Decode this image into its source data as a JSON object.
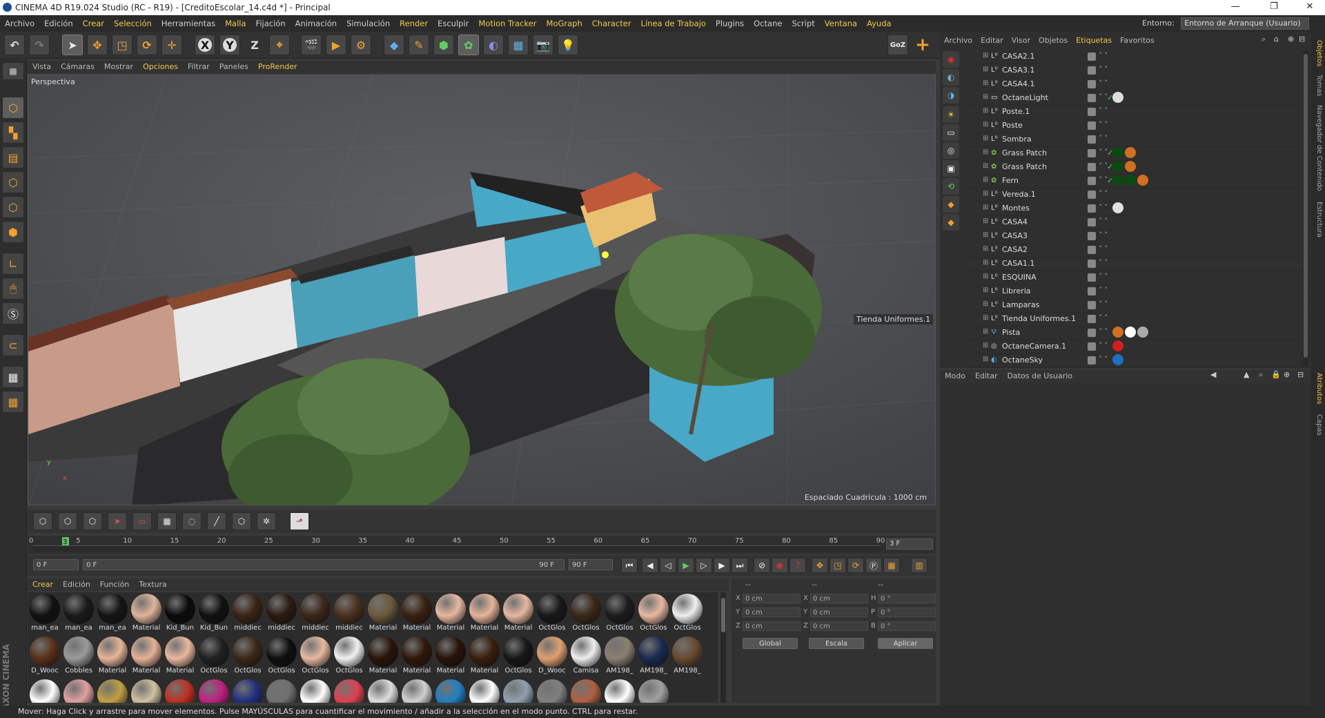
{
  "window": {
    "title": "CINEMA 4D R19.024 Studio (RC - R19) - [CreditoEscolar_14.c4d *] - Principal",
    "controls": [
      "—",
      "❐",
      "✕"
    ]
  },
  "menubar": {
    "items": [
      "Archivo",
      "Edición",
      "Crear",
      "Selección",
      "Herramientas",
      "Malla",
      "Fijación",
      "Animación",
      "Simulación",
      "Render",
      "Esculpir",
      "Motion Tracker",
      "MoGraph",
      "Character",
      "Línea de Trabajo",
      "Plugins",
      "Octane",
      "Script",
      "Ventana",
      "Ayuda"
    ],
    "highlighted": [
      "Crear",
      "Selección",
      "Malla",
      "Render",
      "Motion Tracker",
      "MoGraph",
      "Character",
      "Línea de Trabajo",
      "Ventana",
      "Ayuda"
    ],
    "env_label": "Entorno:",
    "env_value": "Entorno de Arranque (Usuario)"
  },
  "viewport": {
    "menu": [
      "Vista",
      "Cámaras",
      "Mostrar",
      "Opciones",
      "Filtrar",
      "Paneles",
      "ProRender"
    ],
    "menu_highlighted": [
      "Opciones",
      "ProRender"
    ],
    "label": "Perspectiva",
    "grid_info": "Espaciado Cuadrícula : 1000 cm",
    "object_label": "Tienda Uniformes.1",
    "axis_y": "y",
    "axis_x": "x"
  },
  "timeline": {
    "ticks": [
      "0",
      "5",
      "10",
      "15",
      "20",
      "25",
      "30",
      "35",
      "40",
      "45",
      "50",
      "55",
      "60",
      "65",
      "70",
      "75",
      "80",
      "85",
      "90"
    ],
    "current_marker": "3",
    "current_frame": "3 F",
    "start_field": "0 F",
    "range_start": "0 F",
    "range_end": "90 F",
    "end_field": "90 F"
  },
  "materials": {
    "menu": [
      "Crear",
      "Edición",
      "Función",
      "Textura"
    ],
    "menu_highlighted": [
      "Crear"
    ],
    "row1": [
      {
        "name": "man_ea",
        "color": "#111111"
      },
      {
        "name": "man_ea",
        "color": "#1a1a1a"
      },
      {
        "name": "man_ea",
        "color": "#141414"
      },
      {
        "name": "Material",
        "color": "#e0b49a"
      },
      {
        "name": "Kid_Bun",
        "color": "#0a0a0a"
      },
      {
        "name": "Kid_Bun",
        "color": "#101010"
      },
      {
        "name": "middiec",
        "color": "#3a2414"
      },
      {
        "name": "middiec",
        "color": "#2a1a10"
      },
      {
        "name": "middiec",
        "color": "#3c2618"
      },
      {
        "name": "middiec",
        "color": "#4a301c"
      },
      {
        "name": "Material",
        "color": "#6b5a3a"
      },
      {
        "name": "Material",
        "color": "#3a2010"
      },
      {
        "name": "Material",
        "color": "#e8b8a0"
      },
      {
        "name": "Material",
        "color": "#e6b498"
      },
      {
        "name": "Material",
        "color": "#e8b8a0"
      },
      {
        "name": "OctGlos",
        "color": "#181818"
      },
      {
        "name": "OctGlos",
        "color": "#3a2818"
      },
      {
        "name": "OctGlos",
        "color": "#1c1c1c"
      },
      {
        "name": "OctGlos",
        "color": "#e8b8a0"
      },
      {
        "name": "OctGlos",
        "color": "#f0f0f0"
      }
    ],
    "row2": [
      {
        "name": "D_Wooc",
        "color": "#5a3018"
      },
      {
        "name": "Cobbles",
        "color": "#9a9a9a"
      },
      {
        "name": "Material",
        "color": "#e6b498"
      },
      {
        "name": "Material",
        "color": "#e4b296"
      },
      {
        "name": "Material",
        "color": "#e8b8a0"
      },
      {
        "name": "OctGlos",
        "color": "#202020"
      },
      {
        "name": "OctGlos",
        "color": "#3a2818"
      },
      {
        "name": "OctGlos",
        "color": "#0e0e0e"
      },
      {
        "name": "OctGlos",
        "color": "#e8b8a0"
      },
      {
        "name": "OctGlos",
        "color": "#f2f2f2"
      },
      {
        "name": "Material",
        "color": "#2a1408"
      },
      {
        "name": "Material",
        "color": "#301808"
      },
      {
        "name": "Material",
        "color": "#281208"
      },
      {
        "name": "Material",
        "color": "#3a1e0c"
      },
      {
        "name": "OctGlos",
        "color": "#161616"
      },
      {
        "name": "D_Wooc",
        "color": "#e0a070"
      },
      {
        "name": "Camisa",
        "color": "#eeeeee"
      },
      {
        "name": "AM198_",
        "color": "#8a8070"
      },
      {
        "name": "AM198_",
        "color": "#1a2a50"
      },
      {
        "name": "AM198_",
        "color": "#6a4a30"
      }
    ],
    "row3_colors": [
      "#ffffff",
      "#e0a0a0",
      "#c0a040",
      "#d0c0a0",
      "#c03020",
      "#c02080",
      "#203080",
      "#707070",
      "#ffffff",
      "#e04050",
      "#dddddd",
      "#d0d0d0",
      "#2080c0",
      "#ffffff",
      "#90a0b0",
      "#808080",
      "#b06040",
      "#ffffff",
      "#a0a0a0"
    ]
  },
  "coordinates": {
    "headers": [
      "--",
      "--",
      "--"
    ],
    "rows": [
      {
        "a": "X",
        "av": "0 cm",
        "b": "X",
        "bv": "0 cm",
        "c": "H",
        "cv": "0 °"
      },
      {
        "a": "Y",
        "av": "0 cm",
        "b": "Y",
        "bv": "0 cm",
        "c": "P",
        "cv": "0 °"
      },
      {
        "a": "Z",
        "av": "0 cm",
        "b": "Z",
        "bv": "0 cm",
        "c": "B",
        "cv": "0 °"
      }
    ],
    "mode1": "Global",
    "mode2": "Escala",
    "apply": "Aplicar"
  },
  "object_manager": {
    "menu": [
      "Archivo",
      "Editar",
      "Visor",
      "Objetos",
      "Etiquetas",
      "Favoritos"
    ],
    "menu_highlighted": [
      "Etiquetas"
    ],
    "objects": [
      {
        "name": "CASA2.1",
        "icon": "null",
        "tags": []
      },
      {
        "name": "CASA3.1",
        "icon": "null",
        "tags": []
      },
      {
        "name": "CASA4.1",
        "icon": "null",
        "tags": []
      },
      {
        "name": "OctaneLight",
        "icon": "light",
        "check": true,
        "tags": [
          "#dddddd"
        ]
      },
      {
        "name": "Poste.1",
        "icon": "null",
        "tags": []
      },
      {
        "name": "Poste",
        "icon": "null",
        "tags": []
      },
      {
        "name": "Sombra",
        "icon": "null",
        "tags": []
      },
      {
        "name": "Grass Patch",
        "icon": "grass",
        "check": true,
        "tags": [
          "#0a4a10",
          "#d07020"
        ]
      },
      {
        "name": "Grass Patch",
        "icon": "grass",
        "check": true,
        "tags": [
          "#0a4a10",
          "#d07020"
        ]
      },
      {
        "name": "Fern",
        "icon": "grass",
        "check": true,
        "tags": [
          "#0a4a10",
          "#0a4a10",
          "#d07020"
        ]
      },
      {
        "name": "Vereda.1",
        "icon": "null",
        "tags": []
      },
      {
        "name": "Montes",
        "icon": "null",
        "tags": [
          "#e0e0e0"
        ]
      },
      {
        "name": "CASA4",
        "icon": "null",
        "tags": []
      },
      {
        "name": "CASA3",
        "icon": "null",
        "tags": []
      },
      {
        "name": "CASA2",
        "icon": "null",
        "tags": []
      },
      {
        "name": "CASA1.1",
        "icon": "null",
        "tags": []
      },
      {
        "name": "ESQUINA",
        "icon": "null",
        "tags": []
      },
      {
        "name": "Libreria",
        "icon": "null",
        "tags": []
      },
      {
        "name": "Lamparas",
        "icon": "null",
        "tags": []
      },
      {
        "name": "Tienda Uniformes.1",
        "icon": "null",
        "tags": []
      },
      {
        "name": "Pista",
        "icon": "pista",
        "tags": [
          "#d07020",
          "#ffffff",
          "#aaaaaa"
        ]
      },
      {
        "name": "OctaneCamera.1",
        "icon": "camera",
        "tags": [
          "#d02020"
        ]
      },
      {
        "name": "OctaneSky",
        "icon": "sky",
        "tags": [
          "#2070c0"
        ]
      }
    ],
    "side_tabs": [
      "Objetos",
      "Tomas",
      "Navegador de Contenido",
      "Estructura"
    ]
  },
  "attributes": {
    "menu": [
      "Modo",
      "Editar",
      "Datos de Usuario"
    ],
    "side_tabs": [
      "Atributos",
      "Capas"
    ]
  },
  "status": "Mover: Haga Click y arrastre para mover elementos. Pulse MAYÚSCULAS para cuantificar el movimiento / añadir a la selección en el modo punto. CTRL para restar.",
  "brand": "MAXON CINEMA 4D",
  "colors": {
    "accent": "#f2c94c",
    "bg": "#3a3a3a",
    "panel": "#2f2f2f"
  }
}
